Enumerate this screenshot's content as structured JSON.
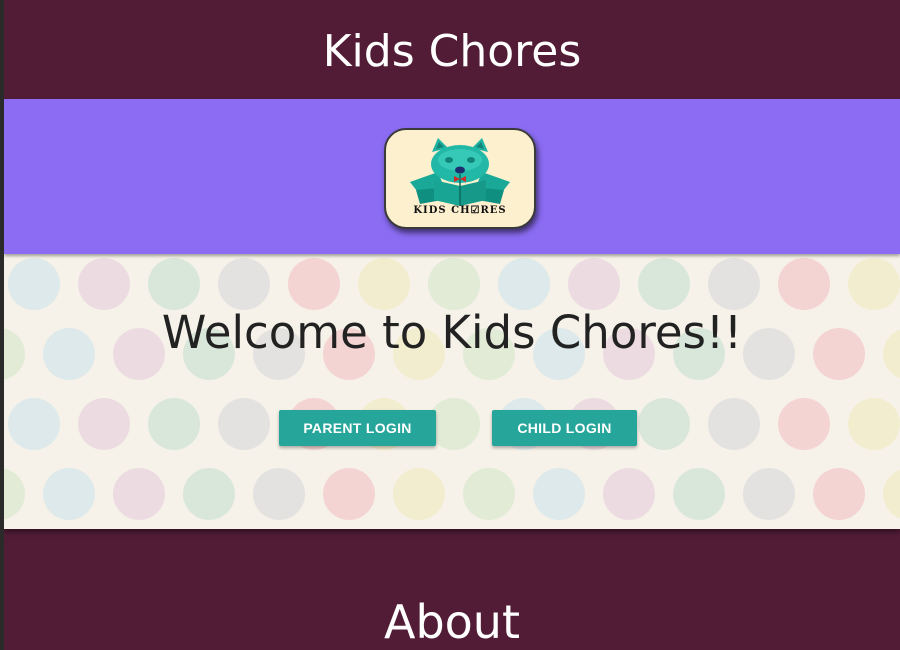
{
  "header": {
    "title": "Kids Chores"
  },
  "logo": {
    "text": "KIDS CH☑RES",
    "icon": "cat-checkmark-logo"
  },
  "hero": {
    "title": "Welcome to Kids Chores!!",
    "background": "polka-dot-pattern"
  },
  "buttons": {
    "parent_login": "PARENT LOGIN",
    "child_login": "CHILD LOGIN"
  },
  "about": {
    "title": "About"
  },
  "colors": {
    "header_bg": "#521c37",
    "logo_band_bg": "#8b6cf3",
    "button_bg": "#26a69a",
    "hero_bg": "#f6f2e9"
  }
}
